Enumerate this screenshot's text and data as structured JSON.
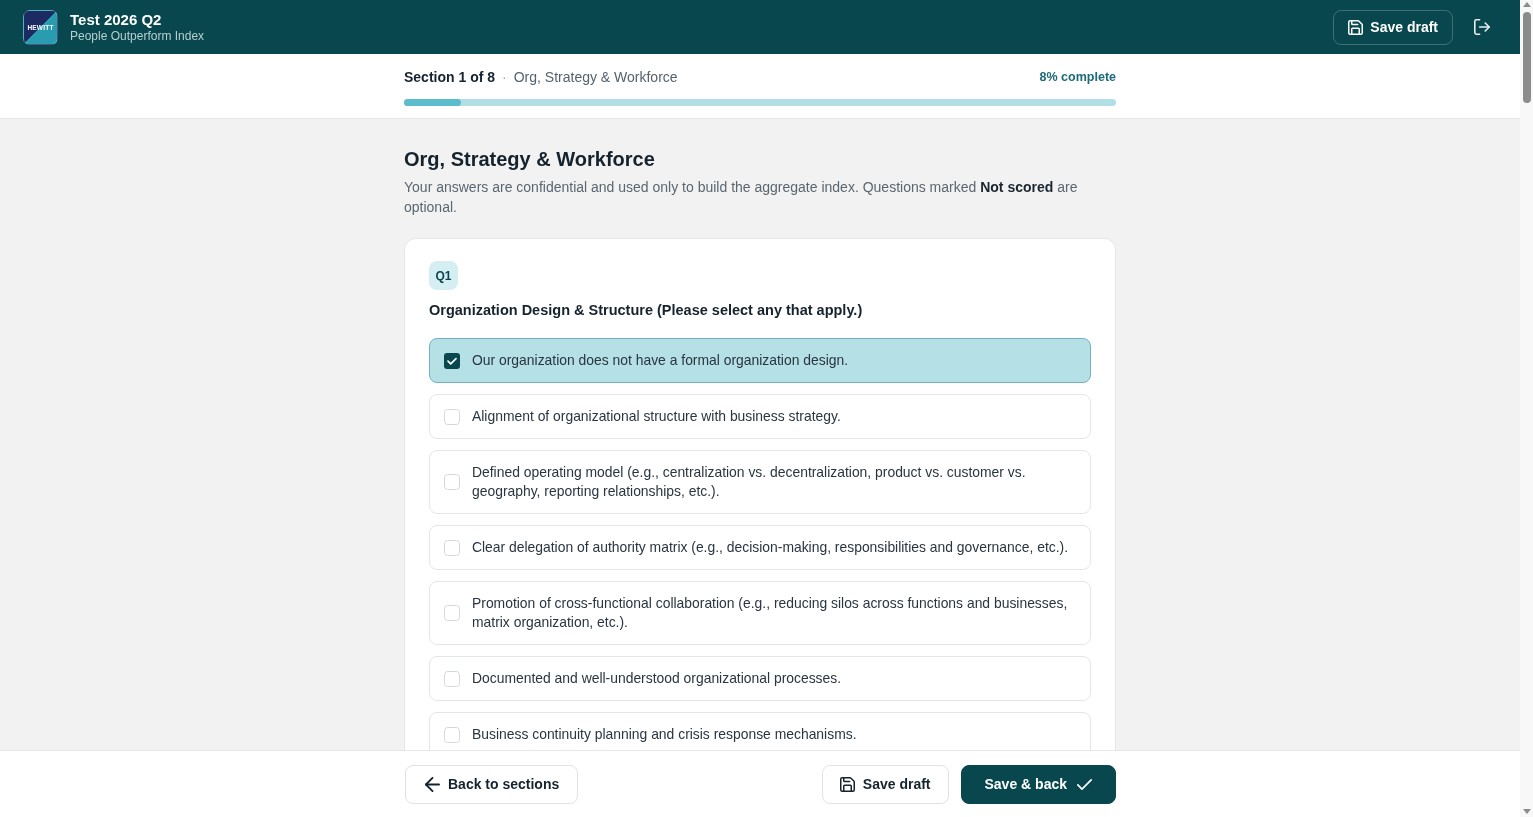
{
  "header": {
    "logo_text": "HEWITT",
    "title": "Test 2026 Q2",
    "subtitle": "People Outperform Index",
    "save_button": "Save draft"
  },
  "progress": {
    "section": "Section 1 of 8",
    "separator": "·",
    "section_name": "Org, Strategy & Workforce",
    "complete_text": "8% complete",
    "level": 0.08
  },
  "section": {
    "title": "Org, Strategy & Workforce",
    "intro": "Your answers are confidential and used only to build the aggregate index. Questions marked **Not scored** are optional."
  },
  "question": {
    "number": "Q1",
    "title": "Organization Design & Structure (Please select any that apply.)",
    "options": [
      {
        "label": "Our organization does not have a formal organization design.",
        "checked": true
      },
      {
        "label": "Alignment of organizational structure with business strategy.",
        "checked": false
      },
      {
        "label": "Defined operating model (e.g., centralization vs. decentralization, product vs. customer vs. geography, reporting relationships, etc.).",
        "checked": false
      },
      {
        "label": "Clear delegation of authority matrix (e.g., decision-making, responsibilities and governance, etc.).",
        "checked": false
      },
      {
        "label": "Promotion of cross-functional collaboration (e.g., reducing silos across functions and businesses, matrix organization, etc.).",
        "checked": false
      },
      {
        "label": "Documented and well-understood organizational processes.",
        "checked": false
      },
      {
        "label": "Business continuity planning and crisis response mechanisms.",
        "checked": false
      }
    ]
  },
  "footer": {
    "back_button": "Back to sections",
    "save_draft_button": "Save draft",
    "save_back_button": "Save & back"
  }
}
